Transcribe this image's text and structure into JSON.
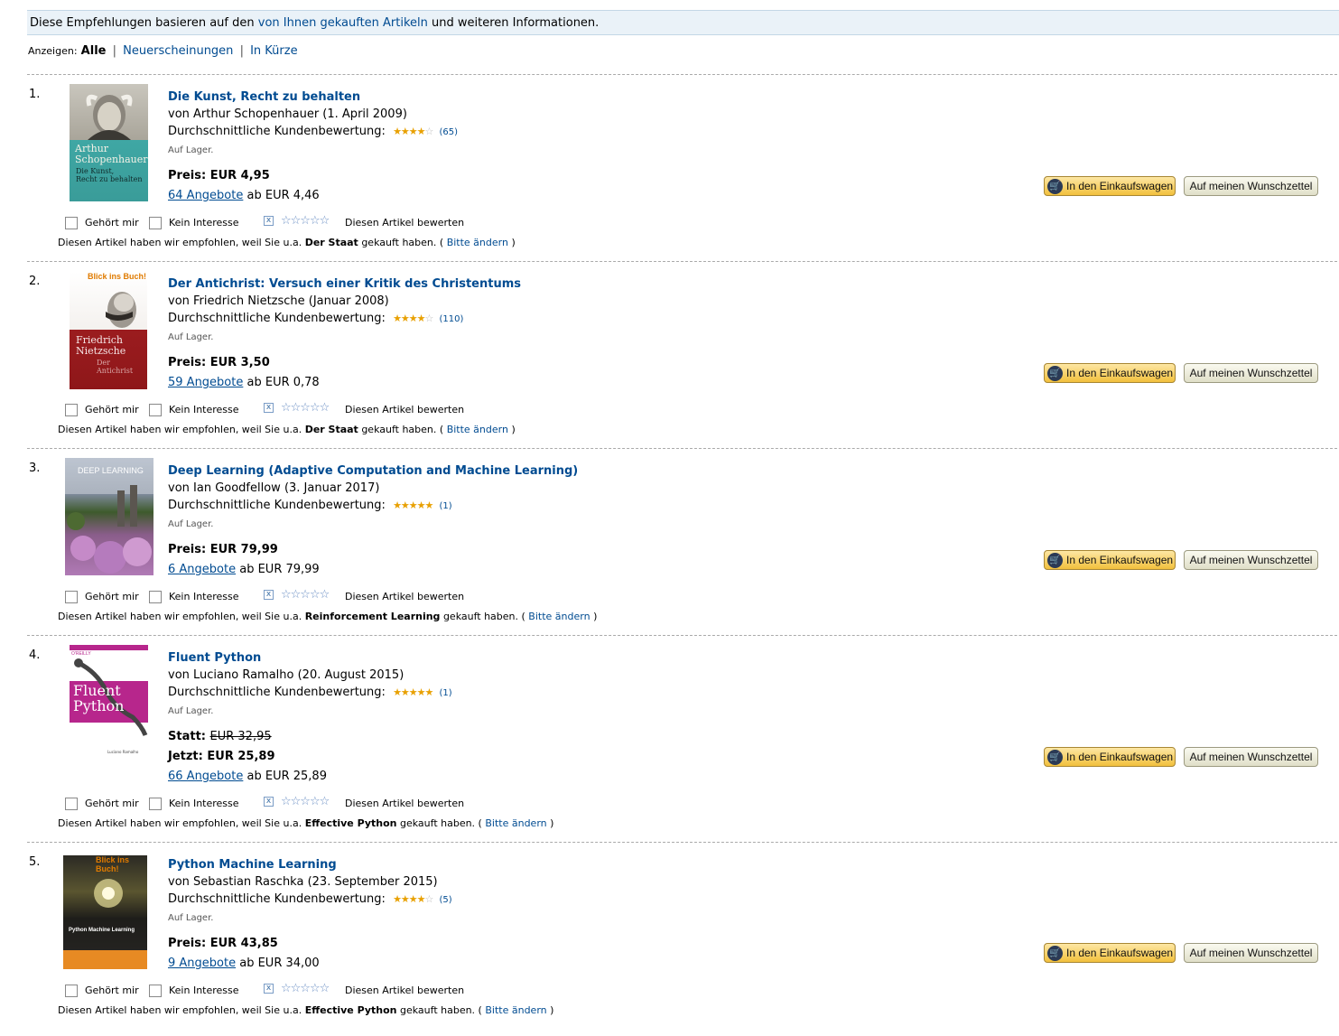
{
  "info_bar": {
    "prefix": "Diese Empfehlungen basieren auf den",
    "link": "von Ihnen gekauften Artikeln",
    "suffix": "und weiteren Informationen."
  },
  "filter": {
    "label": "Anzeigen:",
    "active": "Alle",
    "options": [
      "Neuerscheinungen",
      "In Kürze"
    ]
  },
  "labels": {
    "rating_label": "Durchschnittliche Kundenbewertung:",
    "stock": "Auf Lager.",
    "price_label": "Preis:",
    "was_label": "Statt:",
    "now_label": "Jetzt:",
    "offers_from": "ab",
    "cart_button": "In den Einkaufswagen",
    "wishlist_button": "Auf meinen Wunschzettel",
    "owned": "Gehört mir",
    "not_interested": "Kein Interesse",
    "rate_item": "Diesen Artikel bewerten",
    "reason_prefix": "Diesen Artikel haben wir empfohlen, weil Sie u.a.",
    "reason_suffix": "gekauft haben. (",
    "change_link": "Bitte ändern",
    "reason_close": ")"
  },
  "items": [
    {
      "rank": "1.",
      "title": "Die Kunst, Recht zu behalten",
      "byline": "von Arthur Schopenhauer (1. April 2009)",
      "stars": 4,
      "rating_count": "(65)",
      "price": "EUR 4,95",
      "offers_link": "64 Angebote",
      "offers_price": "EUR 4,46",
      "because": "Der Staat",
      "cover_text": [
        "Arthur",
        "Schopenhauer",
        "Die Kunst,",
        "Recht zu behalten"
      ]
    },
    {
      "rank": "2.",
      "title": "Der Antichrist: Versuch einer Kritik des Christentums",
      "byline": "von Friedrich Nietzsche (Januar 2008)",
      "stars": 4,
      "rating_count": "(110)",
      "price": "EUR 3,50",
      "offers_link": "59 Angebote",
      "offers_price": "EUR 0,78",
      "because": "Der Staat",
      "cover_text": [
        "Blick ins Buch!",
        "Friedrich",
        "Nietzsche",
        "Der Antichrist"
      ]
    },
    {
      "rank": "3.",
      "title": "Deep Learning (Adaptive Computation and Machine Learning)",
      "byline": "von Ian Goodfellow (3. Januar 2017)",
      "stars": 5,
      "rating_count": "(1)",
      "price": "EUR 79,99",
      "offers_link": "6 Angebote",
      "offers_price": "EUR 79,99",
      "because": "Reinforcement Learning",
      "cover_text": [
        "DEEP LEARNING"
      ]
    },
    {
      "rank": "4.",
      "title": "Fluent Python",
      "byline": "von Luciano Ramalho (20. August 2015)",
      "stars": 5,
      "rating_count": "(1)",
      "was_price": "EUR 32,95",
      "now_price": "EUR 25,89",
      "offers_link": "66 Angebote",
      "offers_price": "EUR 25,89",
      "because": "Effective Python",
      "cover_text": [
        "O'REILLY",
        "Fluent",
        "Python",
        "Luciano Ramalho"
      ]
    },
    {
      "rank": "5.",
      "title": "Python Machine Learning",
      "byline": "von Sebastian Raschka (23. September 2015)",
      "stars": 4,
      "rating_count": "(5)",
      "price": "EUR 43,85",
      "offers_link": "9 Angebote",
      "offers_price": "EUR 34,00",
      "because": "Effective Python",
      "cover_text": [
        "Blick ins Buch!",
        "Python Machine Learning"
      ]
    }
  ],
  "colors": {
    "link": "#004b91",
    "info_bar_bg": "#eaf2f8",
    "star_filled": "#e8a000",
    "cart_button": "#f2c03d"
  }
}
